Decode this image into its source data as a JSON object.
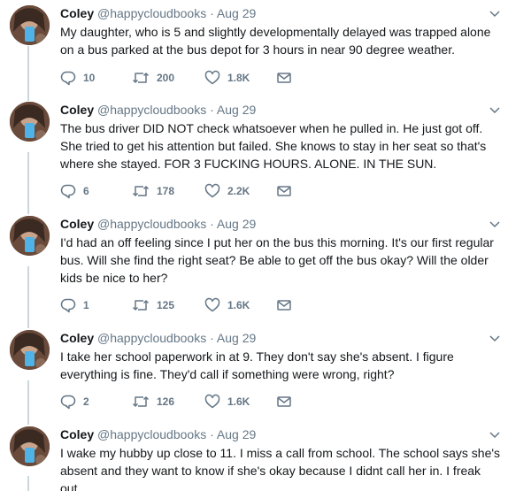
{
  "author": {
    "name": "Coley",
    "handle": "@happycloudbooks",
    "separator": "·"
  },
  "icons": {
    "reply": "reply-icon",
    "retweet": "retweet-icon",
    "like": "heart-icon",
    "dm": "envelope-icon",
    "menu": "chevron-down-icon"
  },
  "colors": {
    "text": "#14171a",
    "secondary": "#657786",
    "thread_line": "#ccd6dd"
  },
  "tweets": [
    {
      "date": "Aug 29",
      "text": "My daughter, who is 5 and slightly developmentally delayed was trapped alone on a bus parked at the bus depot for 3 hours in near 90 degree weather.",
      "replies": "10",
      "retweets": "200",
      "likes": "1.8K"
    },
    {
      "date": "Aug 29",
      "text": "The bus driver DID NOT check whatsoever when he pulled in. He just got off. She tried to get his attention but failed. She knows to stay in her seat so that's where she stayed. FOR 3 FUCKING HOURS. ALONE. IN THE SUN.",
      "replies": "6",
      "retweets": "178",
      "likes": "2.2K"
    },
    {
      "date": "Aug 29",
      "text": "I'd had an off feeling since I put her on the bus this morning. It's our first regular bus. Will she find the right seat? Be able to get off the bus okay? Will the older kids be nice to her?",
      "replies": "1",
      "retweets": "125",
      "likes": "1.6K"
    },
    {
      "date": "Aug 29",
      "text": "I take her school paperwork in at 9. They don't say she's absent. I figure everything is fine. They'd call if something were wrong, right?",
      "replies": "2",
      "retweets": "126",
      "likes": "1.6K"
    },
    {
      "date": "Aug 29",
      "text": "I wake my hubby up close to 11. I miss a call from school. The school says she's absent and they want to know if she's okay because I didnt call her in. I freak out."
    }
  ]
}
